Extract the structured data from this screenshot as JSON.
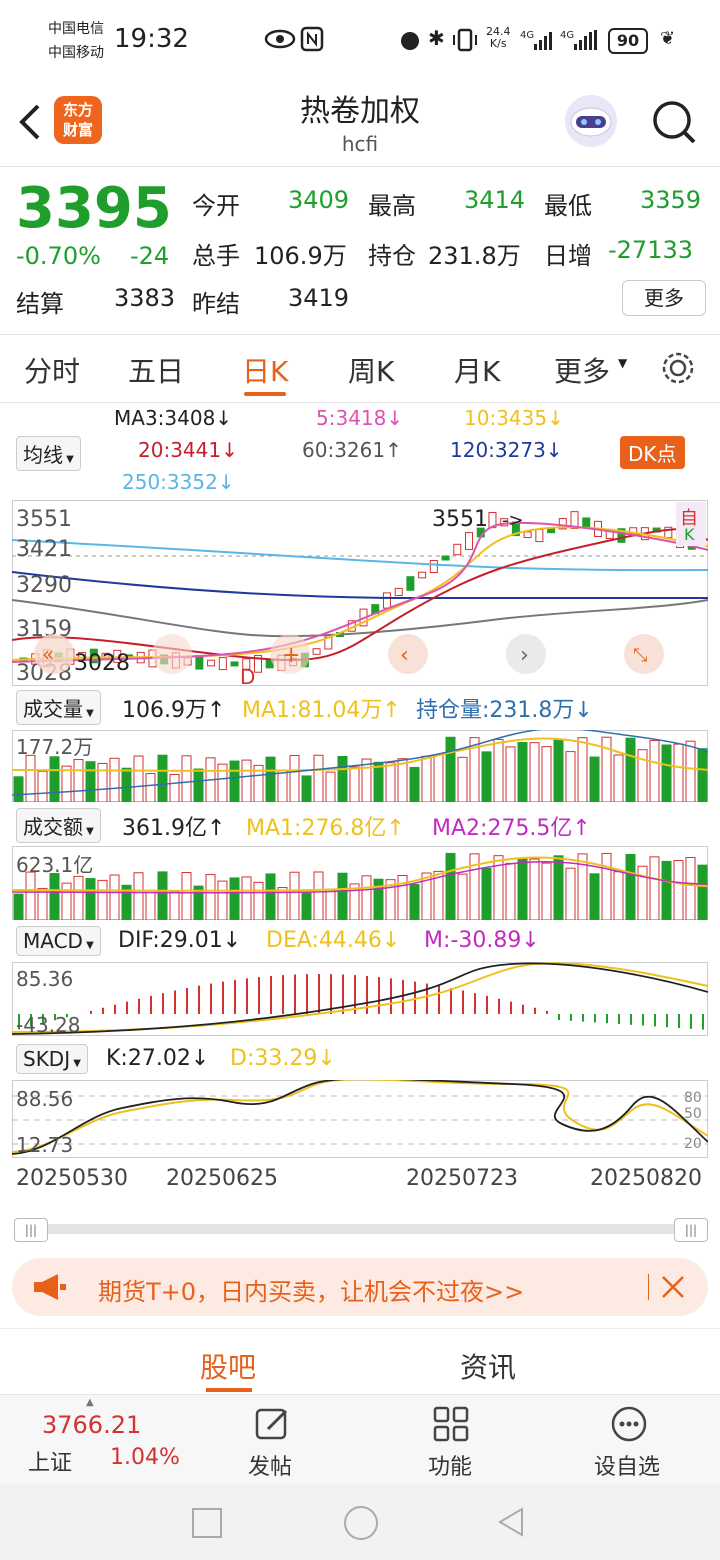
{
  "status_bar": {
    "carrier1": "中国电信",
    "carrier2": "中国移动",
    "time": "19:32",
    "net_speed_top": "24.4",
    "net_speed_unit": "K/s",
    "battery": "90"
  },
  "header": {
    "title": "热卷加权",
    "subtitle": "hcfi",
    "logo_line1": "东方",
    "logo_line2": "财富"
  },
  "quote": {
    "price": "3395",
    "pct": "-0.70%",
    "change": "-24",
    "open_label": "今开",
    "open": "3409",
    "high_label": "最高",
    "high": "3414",
    "low_label": "最低",
    "low": "3359",
    "vol_label": "总手",
    "vol": "106.9万",
    "oi_label": "持仓",
    "oi": "231.8万",
    "daily_label": "日增",
    "daily": "-27133",
    "settle_label": "结算",
    "settle": "3383",
    "prev_label": "昨结",
    "prev": "3419",
    "more": "更多"
  },
  "tabs": [
    "分时",
    "五日",
    "日K",
    "周K",
    "月K",
    "更多"
  ],
  "ma": {
    "selector": "均线",
    "ma3": "MA3:3408↓",
    "ma5": "5:3418↓",
    "ma10": "10:3435↓",
    "ma20": "20:3441↓",
    "ma60": "60:3261↑",
    "ma120": "120:3273↓",
    "ma250": "250:3352↓",
    "dk": "DK点"
  },
  "kline": {
    "y_labels": [
      "3551",
      "3421",
      "3290",
      "3159",
      "3028"
    ],
    "max_label": "3551",
    "min_label": "3028",
    "right_label_1": "自",
    "right_label_2": "K",
    "d_marker": "D"
  },
  "volume": {
    "selector": "成交量",
    "value": "106.9万↑",
    "ma1": "MA1:81.04万↑",
    "oi": "持仓量:231.8万↓",
    "axis": "177.2万"
  },
  "amount": {
    "selector": "成交额",
    "value": "361.9亿↑",
    "ma1": "MA1:276.8亿↑",
    "ma2": "MA2:275.5亿↑",
    "axis": "623.1亿"
  },
  "macd": {
    "selector": "MACD",
    "dif": "DIF:29.01↓",
    "dea": "DEA:44.46↓",
    "m": "M:-30.89↓",
    "axis_top": "85.36",
    "axis_bottom": "-43.28"
  },
  "skdj": {
    "selector": "SKDJ",
    "k": "K:27.02↓",
    "d": "D:33.29↓",
    "axis_top": "88.56",
    "axis_bottom": "12.73",
    "r80": "80",
    "r50": "50",
    "r20": "20"
  },
  "dates": [
    "20250530",
    "20250625",
    "20250723",
    "20250820"
  ],
  "banner": {
    "text": "期货T+0，日内买卖，让机会不过夜>>"
  },
  "bottom_tabs": [
    "股吧",
    "资讯"
  ],
  "bottom_nav": {
    "index_value": "3766.21",
    "index_name": "上证",
    "index_pct": "1.04%",
    "post": "发帖",
    "func": "功能",
    "watch": "设自选"
  },
  "colors": {
    "up": "#d23232",
    "down": "#1f9e2c",
    "accent": "#e8611a"
  }
}
